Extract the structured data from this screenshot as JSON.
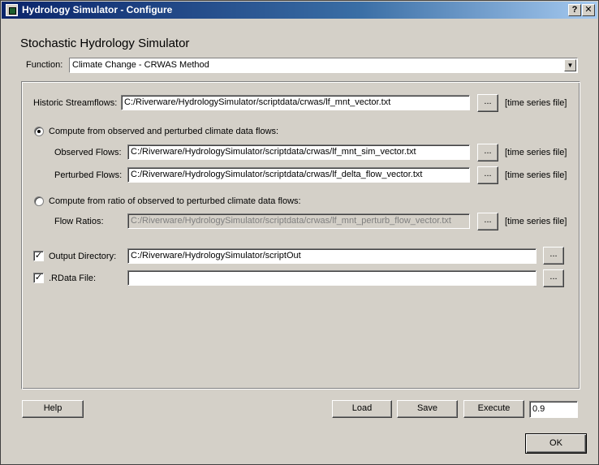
{
  "window": {
    "title": "Hydrology Simulator - Configure",
    "help_btn": "?",
    "close_btn": "✕"
  },
  "heading": "Stochastic Hydrology Simulator",
  "function": {
    "label": "Function:",
    "value": "Climate Change - CRWAS Method"
  },
  "historic": {
    "label": "Historic Streamflows:",
    "value": "C:/Riverware/HydrologySimulator/scriptdata/crwas/lf_mnt_vector.txt",
    "browse": "...",
    "hint": "[time series file]"
  },
  "option_observed": {
    "label": "Compute from observed and perturbed climate data flows:",
    "selected": true,
    "observed": {
      "label": "Observed Flows:",
      "value": "C:/Riverware/HydrologySimulator/scriptdata/crwas/lf_mnt_sim_vector.txt",
      "browse": "...",
      "hint": "[time series file]"
    },
    "perturbed": {
      "label": "Perturbed Flows:",
      "value": "C:/Riverware/HydrologySimulator/scriptdata/crwas/lf_delta_flow_vector.txt",
      "browse": "...",
      "hint": "[time series file]"
    }
  },
  "option_ratio": {
    "label": "Compute from ratio of observed to perturbed climate data flows:",
    "selected": false,
    "ratios": {
      "label": "Flow Ratios:",
      "value": "C:/Riverware/HydrologySimulator/scriptdata/crwas/lf_mnt_perturb_flow_vector.txt",
      "browse": "...",
      "hint": "[time series file]"
    }
  },
  "output_dir": {
    "label": "Output Directory:",
    "checked": true,
    "value": "C:/Riverware/HydrologySimulator/scriptOut",
    "browse": "..."
  },
  "rdata": {
    "label": ".RData File:",
    "checked": true,
    "value": "",
    "browse": "..."
  },
  "buttons": {
    "help": "Help",
    "load": "Load",
    "save": "Save",
    "execute": "Execute",
    "version": "0.9",
    "ok": "OK"
  },
  "check_mark": "✓"
}
